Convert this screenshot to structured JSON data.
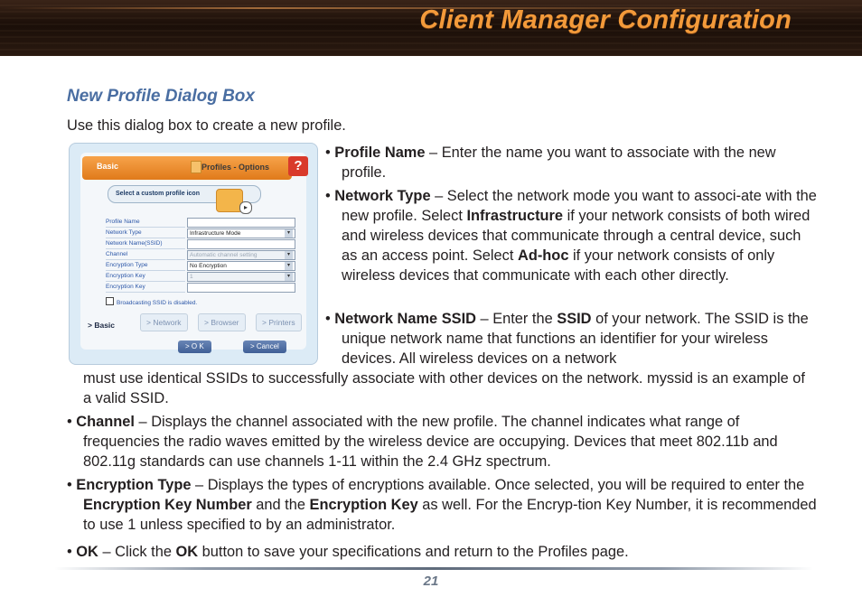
{
  "header": {
    "title": "Client Manager Configuration"
  },
  "section_title": "New Profile Dialog Box",
  "intro": "Use this dialog box to create a new profile.",
  "bullets": {
    "profile_name": {
      "term": "Profile Name",
      "text": " – Enter the name you want to associate with the new profile."
    },
    "network_type": {
      "term": "Network Type",
      "text1": " – Select the network mode you want to associ-ate with the new profile. Select ",
      "term2": "Infrastructure",
      "text2": " if your network consists of both wired and wireless devices that communicate through a central device, such as an access point. Select ",
      "term3": "Ad-hoc",
      "text3": " if your network consists of only wireless devices that communicate with each other directly."
    },
    "ssid": {
      "term": "Network Name SSID",
      "text1": " – Enter the ",
      "term2": "SSID",
      "text2": " of your network. The SSID is the unique network name that functions an identifier for your wireless devices. All wireless devices on a network",
      "text3": "must use identical SSIDs to successfully associate with other devices on the network. myssid is an example of a valid SSID."
    },
    "channel": {
      "term": "Channel",
      "text": " – Displays the channel associated with the new profile. The channel indicates what range of frequencies the radio waves emitted by the wireless device are occupying. Devices that meet 802.11b and 802.11g standards can use channels 1-11 within the 2.4 GHz spectrum."
    },
    "encryption": {
      "term": "Encryption Type",
      "text1": " –  Displays the types of encryptions available.  Once selected, you will be required to enter the ",
      "term2": "Encryption Key Number",
      "text2": " and the ",
      "term3": "Encryption Key",
      "text3": " as well.  For the Encryp-tion Key Number, it is recommended to use 1 unless specified to by an administrator."
    },
    "ok": {
      "term": "OK",
      "text1": " – Click the ",
      "term2": "OK",
      "text2": " button to save your specifications and return to the Profiles page."
    }
  },
  "dialog": {
    "tab_label": "Basic",
    "header_right": "Profiles - Options",
    "help": "?",
    "icon_selector": "Select a custom profile icon",
    "arrow": "▸",
    "fields": [
      {
        "label": "Profile Name",
        "value": ""
      },
      {
        "label": "Network Type",
        "value": "Infrastructure Mode"
      },
      {
        "label": "Network Name(SSID)",
        "value": ""
      },
      {
        "label": "Channel",
        "value": "Automatic channel setting"
      },
      {
        "label": "Encryption Type",
        "value": "No Encryption"
      },
      {
        "label": "Encryption Key",
        "value": "1"
      },
      {
        "label": "Encryption Key",
        "value": ""
      }
    ],
    "broadcast": "Broadcasting SSID is disabled.",
    "tabs": [
      "> Basic",
      "> Network",
      "> Browser",
      "> Printers"
    ],
    "ok_button": ">   O K",
    "cancel_button": "> Cancel"
  },
  "footer": {
    "page_number": "21"
  }
}
